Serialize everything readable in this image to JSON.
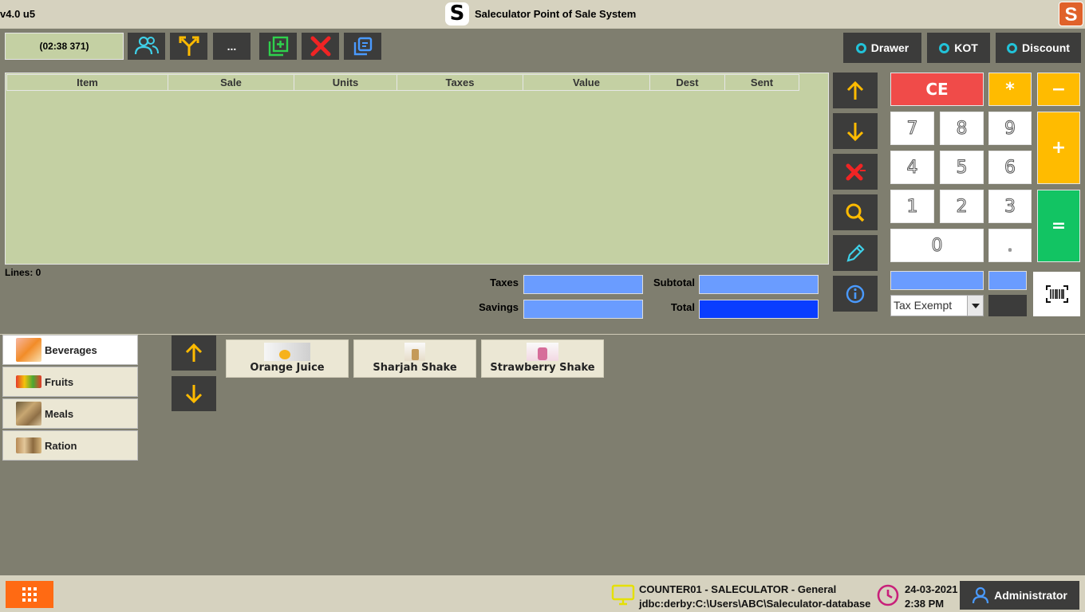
{
  "window": {
    "version": "v4.0 u5",
    "title": "Saleculator Point of Sale System",
    "logo_letter": "S",
    "corner_logo_letter": "S"
  },
  "toolbar": {
    "clock": "(02:38 371)",
    "more_label": "...",
    "toggles": [
      "Drawer",
      "KOT",
      "Discount"
    ]
  },
  "ticket": {
    "columns": [
      "Item",
      "Sale",
      "Units",
      "Taxes",
      "Value",
      "Dest",
      "Sent"
    ],
    "rows": [],
    "lines_label": "Lines: 0"
  },
  "totals": {
    "taxes_label": "Taxes",
    "savings_label": "Savings",
    "subtotal_label": "Subtotal",
    "total_label": "Total",
    "taxes_value": "",
    "savings_value": "",
    "subtotal_value": "",
    "total_value": ""
  },
  "keypad": {
    "ce": "CE",
    "multiply": "*",
    "minus": "−",
    "plus": "+",
    "equals": "=",
    "digits": [
      "7",
      "8",
      "9",
      "4",
      "5",
      "6",
      "1",
      "2",
      "3",
      "0",
      "."
    ]
  },
  "tax": {
    "selected": "Tax Exempt"
  },
  "categories": [
    {
      "label": "Beverages",
      "active": true
    },
    {
      "label": "Fruits",
      "active": false
    },
    {
      "label": "Meals",
      "active": false
    },
    {
      "label": "Ration",
      "active": false
    }
  ],
  "products": [
    "Orange Juice",
    "Sharjah Shake",
    "Strawberry Shake"
  ],
  "status": {
    "line1": "COUNTER01 - SALECULATOR - General",
    "line2": "jdbc:derby:C:\\Users\\ABC\\Saleculator-database",
    "date": "24-03-2021",
    "time": "2:38 PM",
    "user": "Administrator"
  },
  "colors": {
    "background": "#7f7e6f",
    "ticket": "#c4d0a3",
    "accent_yellow": "#ffbb00",
    "ce_red": "#f04b49",
    "equals_green": "#12c463",
    "total_blue": "#0a3dff"
  }
}
